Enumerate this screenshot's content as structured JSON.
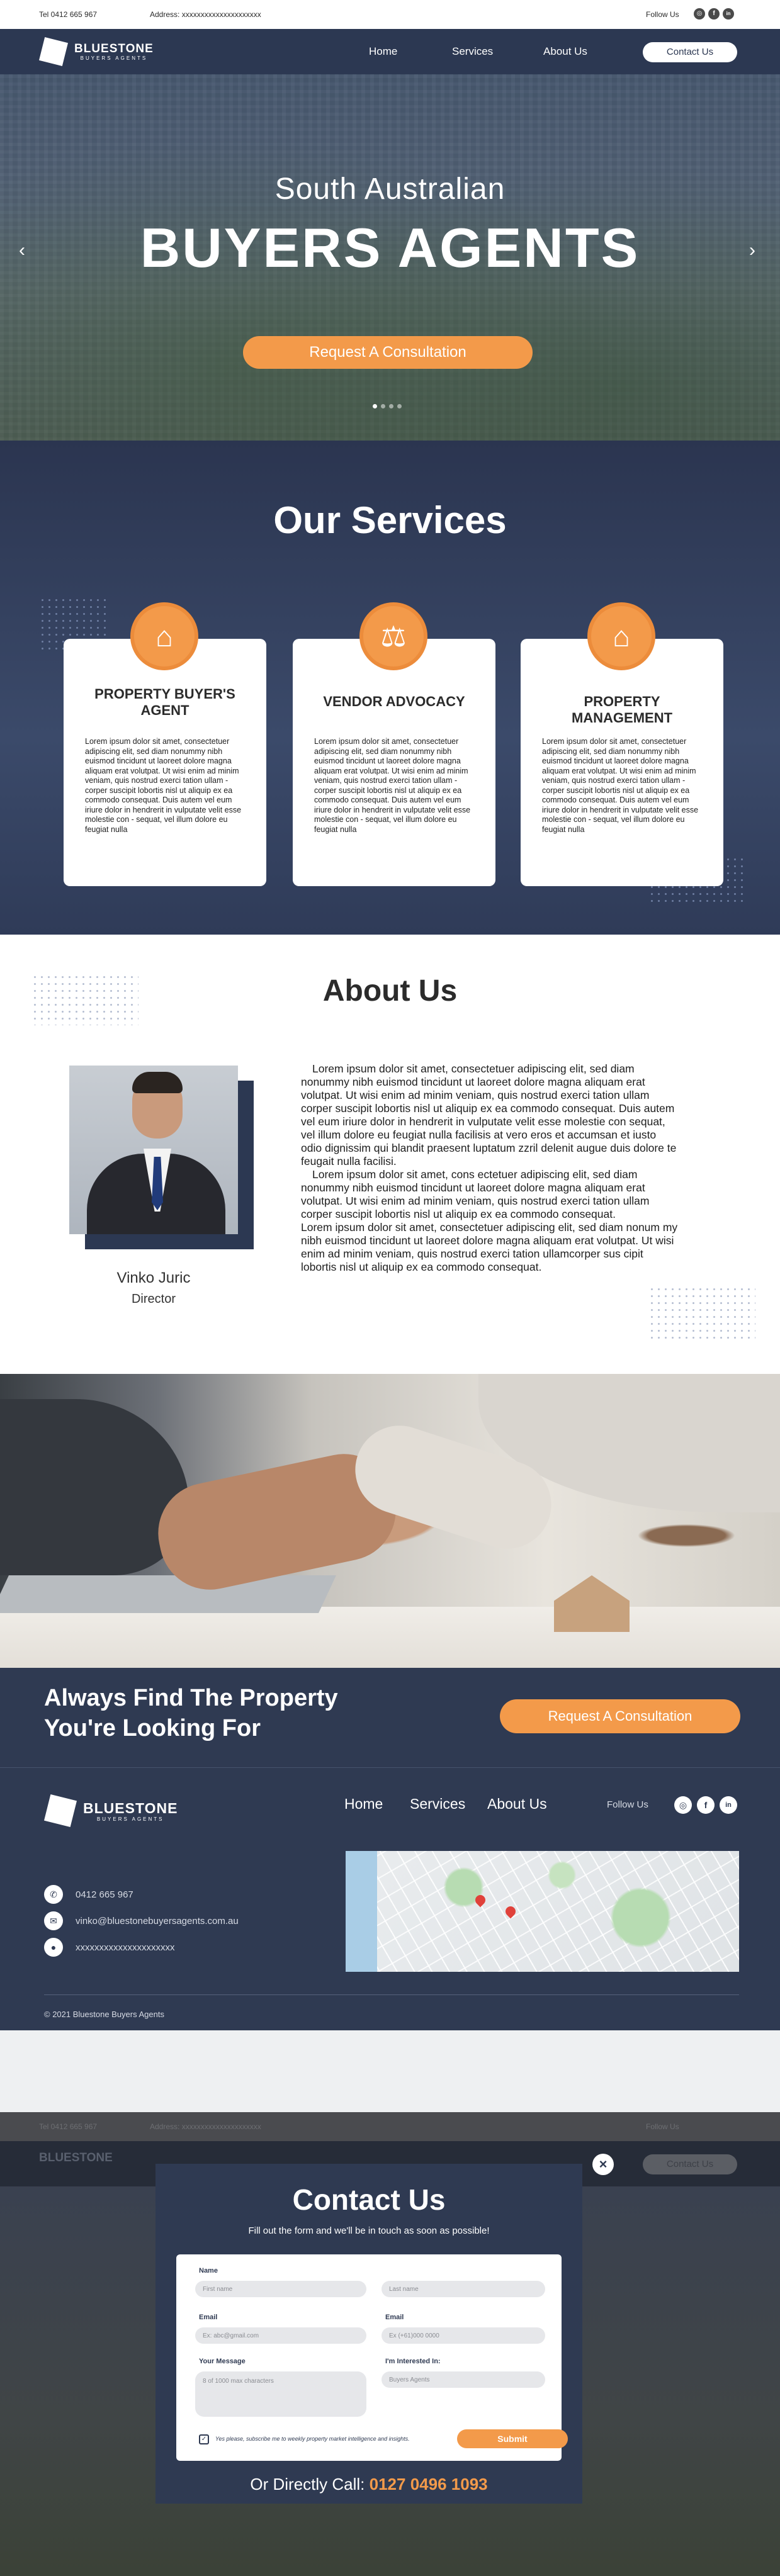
{
  "topbar": {
    "tel": "Tel 0412 665 967",
    "address": "Address: xxxxxxxxxxxxxxxxxxxxx",
    "follow_label": "Follow Us",
    "social_icons": [
      "instagram-icon",
      "facebook-icon",
      "linkedin-icon"
    ]
  },
  "nav": {
    "logo_name": "BLUESTONE",
    "logo_sub": "BUYERS AGENTS",
    "links": [
      "Home",
      "Services",
      "About Us"
    ],
    "contact_button": "Contact Us"
  },
  "hero": {
    "line1": "South Australian",
    "line2": "BUYERS AGENTS",
    "cta": "Request A Consultation",
    "slides_total": 4,
    "slide_active": 1
  },
  "services": {
    "title": "Our Services",
    "cards": [
      {
        "icon": "house-icon",
        "title": "PROPERTY BUYER'S AGENT",
        "body": "Lorem ipsum dolor sit amet, consectetuer adipiscing elit, sed diam nonummy nibh euismod tincidunt ut laoreet dolore magna aliquam erat volutpat. Ut wisi enim ad minim veniam, quis nostrud exerci tation ullam - corper suscipit lobortis nisl ut aliquip ex ea commodo consequat. Duis autem vel eum iriure dolor in hendrerit in vulputate velit esse molestie con - sequat, vel illum dolore eu feugiat nulla"
      },
      {
        "icon": "scales-icon",
        "title": "VENDOR ADVOCACY",
        "body": "Lorem ipsum dolor sit amet, consectetuer adipiscing elit, sed diam nonummy nibh euismod tincidunt ut laoreet dolore magna aliquam erat volutpat. Ut wisi enim ad minim veniam, quis nostrud exerci tation ullam - corper suscipit lobortis nisl ut aliquip ex ea commodo consequat. Duis autem vel eum iriure dolor in hendrerit in vulputate velit esse molestie con - sequat, vel illum dolore eu feugiat nulla"
      },
      {
        "icon": "hand-house-icon",
        "title": "PROPERTY MANAGEMENT",
        "body": "Lorem ipsum dolor sit amet, consectetuer adipiscing elit, sed diam nonummy nibh euismod tincidunt ut laoreet dolore magna aliquam erat volutpat. Ut wisi enim ad minim veniam, quis nostrud exerci tation ullam - corper suscipit lobortis nisl ut aliquip ex ea commodo consequat. Duis autem vel eum iriure dolor in hendrerit in vulputate velit esse molestie con - sequat, vel illum dolore eu feugiat nulla"
      }
    ]
  },
  "about": {
    "title": "About Us",
    "person_name": "Vinko Juric",
    "person_role": "Director",
    "paragraphs": [
      "Lorem ipsum dolor sit amet, consectetuer adipiscing elit, sed diam nonummy nibh euismod tincidunt ut laoreet dolore magna aliquam erat volutpat. Ut wisi enim ad minim veniam, quis nostrud exerci tation ullam corper suscipit lobortis nisl ut aliquip ex ea commodo consequat. Duis autem vel eum iriure dolor in hendrerit in vulputate velit esse molestie con sequat, vel illum dolore eu feugiat nulla facilisis at vero eros et accumsan et iusto odio dignissim qui blandit praesent luptatum zzril delenit augue duis dolore te feugait nulla facilisi.",
      "Lorem ipsum dolor sit amet, cons ectetuer adipiscing elit, sed diam nonummy nibh euismod tincidunt ut laoreet dolore magna aliquam erat volutpat. Ut wisi enim ad minim veniam, quis nostrud exerci tation ullam corper suscipit lobortis nisl ut aliquip ex ea commodo consequat.",
      "Lorem ipsum dolor sit amet, consectetuer adipiscing elit, sed diam nonum my nibh euismod tincidunt ut laoreet dolore magna aliquam erat volutpat. Ut wisi enim ad minim veniam, quis nostrud exerci tation ullamcorper sus cipit lobortis nisl ut aliquip ex ea commodo consequat."
    ]
  },
  "band": {
    "headline_line1": "Always Find The Property",
    "headline_line2": "You're Looking For",
    "cta": "Request A Consultation"
  },
  "footer": {
    "logo_name": "BLUESTONE",
    "logo_sub": "BUYERS AGENTS",
    "links": [
      "Home",
      "Services",
      "About Us"
    ],
    "follow_label": "Follow Us",
    "social_icons": [
      "instagram-icon",
      "facebook-icon",
      "linkedin-icon"
    ],
    "phone": "0412 665 967",
    "email": "vinko@bluestonebuyersagents.com.au",
    "address": "xxxxxxxxxxxxxxxxxxxxx",
    "copyright": "© 2021 Bluestone Buyers Agents"
  },
  "modal": {
    "title": "Contact Us",
    "subtitle": "Fill out the form and we'll be in touch as soon as possible!",
    "close": "×",
    "labels": {
      "name": "Name",
      "email1": "Email",
      "email2": "Email",
      "message": "Your Message",
      "interest": "I'm Interested In:"
    },
    "placeholders": {
      "first_name": "First name",
      "last_name": "Last name",
      "email": "Ex: abc@gmail.com",
      "phone": "Ex (+61)000 0000",
      "message": "8 of 1000 max characters",
      "interest": "Buyers Agents"
    },
    "checkbox_label": "Yes please, subscribe me to weekly property market intelligence and insights.",
    "submit": "Submit",
    "call_prefix": "Or Directly Call:",
    "call_number": "0127 0496 1093"
  },
  "dimmed_background": {
    "tel": "Tel 0412 665 967",
    "address": "Address: xxxxxxxxxxxxxxxxxxxxx",
    "follow_label": "Follow Us",
    "logo_name": "BLUESTONE",
    "contact_button": "Contact Us"
  },
  "colors": {
    "navy": "#2c3852",
    "accent_orange": "#f39a4a",
    "white": "#ffffff"
  }
}
